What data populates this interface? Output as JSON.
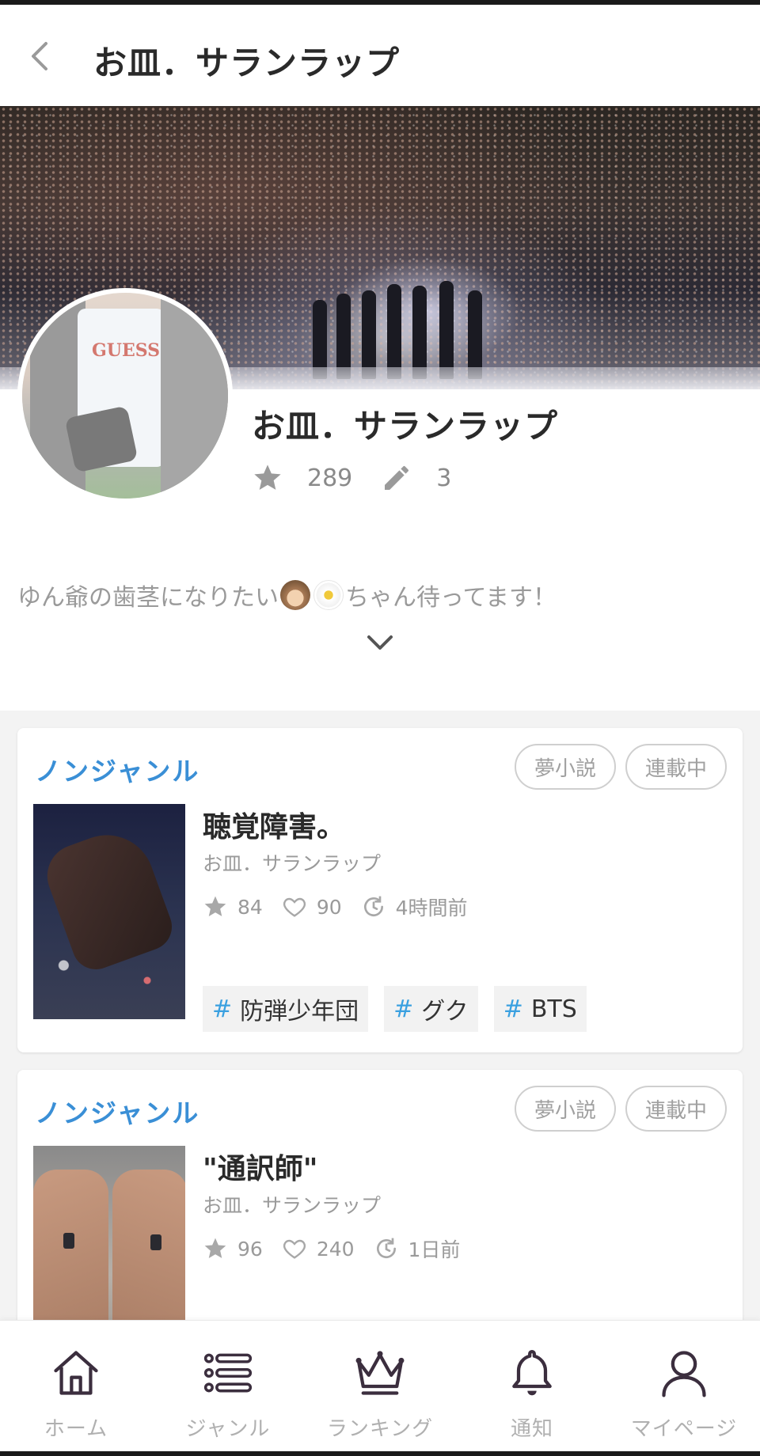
{
  "header": {
    "title": "お皿．サランラップ",
    "back_icon": "chevron-left-icon"
  },
  "profile": {
    "name": "お皿．サランラップ",
    "stars": "289",
    "works": "3",
    "bio_before": "ゆん爺の歯茎になりたい",
    "bio_after": "ちゃん待ってます！",
    "bio_emoji": [
      "hedgehog-emoji",
      "blossom-emoji"
    ]
  },
  "stories": [
    {
      "genre": "ノンジャンル",
      "chip_type": "夢小説",
      "chip_status": "連載中",
      "title": "聴覚障害。",
      "author": "お皿．サランラップ",
      "stars": "84",
      "likes": "90",
      "updated": "4時間前",
      "tags": [
        "防弾少年団",
        "グク",
        "BTS"
      ],
      "hash": "#"
    },
    {
      "genre": "ノンジャンル",
      "chip_type": "夢小説",
      "chip_status": "連載中",
      "title": "\"通訳師\"",
      "author": "お皿．サランラップ",
      "stars": "96",
      "likes": "240",
      "updated": "1日前"
    }
  ],
  "nav": {
    "home": "ホーム",
    "genre": "ジャンル",
    "ranking": "ランキング",
    "notify": "通知",
    "mypage": "マイページ"
  },
  "colors": {
    "accent": "#3a8fd6",
    "hash": "#3aa0e0",
    "nav_icon": "#3b2e3e",
    "muted": "#9a9a9a"
  }
}
